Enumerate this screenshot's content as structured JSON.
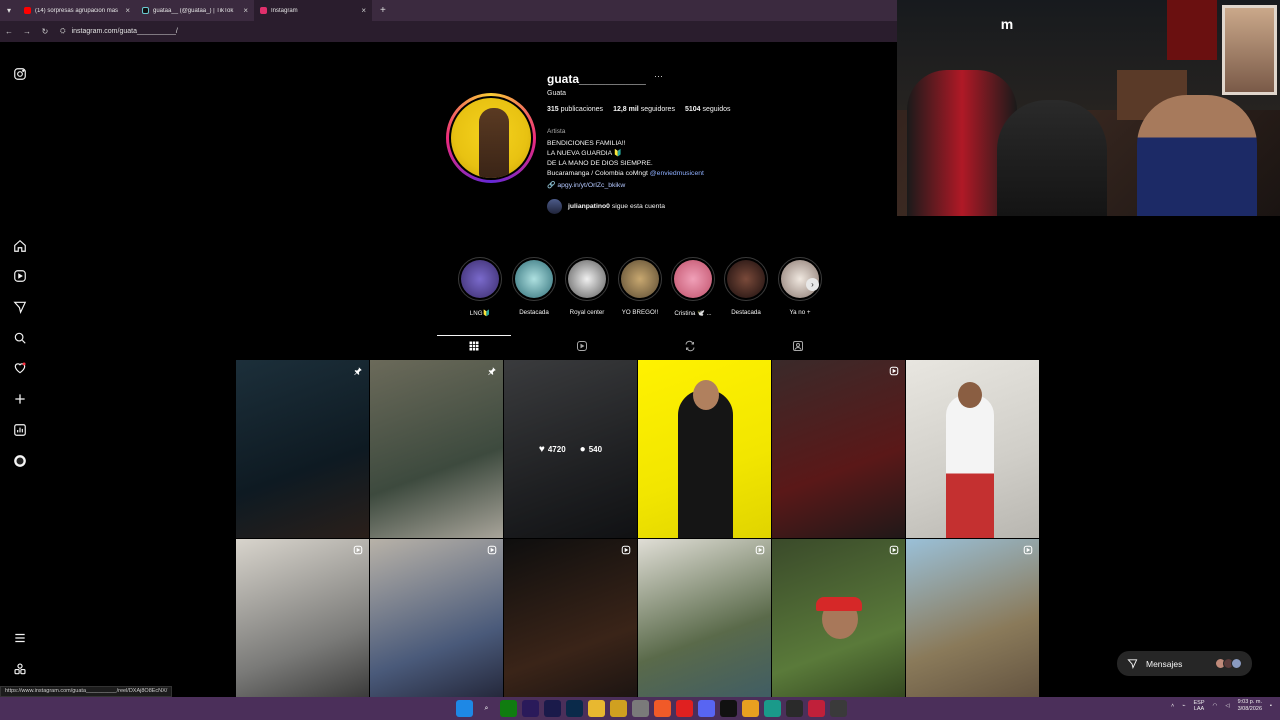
{
  "browser": {
    "tabs": [
      {
        "label": "(14) sorpresas agrupacion mas",
        "favicon_color": "#ff0000",
        "active": false
      },
      {
        "label": "guataa__ (@guataa_) | TikTok",
        "favicon_color": "#111111",
        "active": false
      },
      {
        "label": "Instagram",
        "favicon_color": "#e1306c",
        "active": true
      }
    ],
    "new_tab": "+",
    "close_glyph": "×",
    "url": "instagram.com/guata__________/",
    "status_link": "https://www.instagram.com/guata__________/reel/DXAj8O8EcNX/"
  },
  "profile": {
    "username": "guata__________",
    "more": "···",
    "full_name": "Guata",
    "stats": {
      "posts_count": "315",
      "posts_label": "publicaciones",
      "followers_count": "12,8 mil",
      "followers_label": "seguidores",
      "following_count": "5104",
      "following_label": "seguidos"
    },
    "category": "Artista",
    "bio_line1": "BENDICIONES FAMILIA!!",
    "bio_line2": "LA NUEVA GUARDIA 🔰",
    "bio_line3": "DE LA MANO DE DIOS SIEMPRE.",
    "bio_line4_prefix": "Bucaramanga / Colombia coMngt",
    "bio_mention": "@enviedmusicent",
    "link": "apgy.in/yt/OrlZc_bkikw",
    "followed_by_user": "julianpatino0",
    "followed_by_text": "sigue esta cuenta"
  },
  "highlights": [
    {
      "label": "LNG🔰",
      "color": "#3a2b6a"
    },
    {
      "label": "Destacada",
      "color": "#2f6e78"
    },
    {
      "label": "Royal center",
      "color": "#d8d8d8"
    },
    {
      "label": "YO BREGO!!",
      "color": "#5a4a32"
    },
    {
      "label": "Cristina 🕊️ ...",
      "color": "#c0506a"
    },
    {
      "label": "Destacada",
      "color": "#2a1a1a"
    },
    {
      "label": "Ya no +",
      "color": "#c8b8b0"
    }
  ],
  "hover_stats": {
    "likes": "4720",
    "comments": "540"
  },
  "posts": [
    {
      "bg": "linear-gradient(160deg,#1c2f3a,#0e1a22 60%,#2a1f1a)",
      "badge": "pin"
    },
    {
      "bg": "linear-gradient(160deg,#6b6a5a,#3d4a3e 60%,#a8a49a)",
      "badge": "pin"
    },
    {
      "bg": "linear-gradient(160deg,#6a6c70,#3a3c40 60%,#1e2024)",
      "badge": "none"
    },
    {
      "bg": "linear-gradient(160deg,#fff200,#f2e600 60%,#e0d400)",
      "badge": "none"
    },
    {
      "bg": "linear-gradient(160deg,#3a2a2a,#5a1818 60%,#201818)",
      "badge": "reel"
    },
    {
      "bg": "linear-gradient(160deg,#e8e6e0,#d0cec8 60%,#b8b6b0)",
      "badge": "none"
    },
    {
      "bg": "linear-gradient(160deg,#d8d4cc,#7a7a78 60%,#2a2a2a)",
      "badge": "reel"
    },
    {
      "bg": "linear-gradient(160deg,#b8b2a8,#4a5a7a 60%,#1a1a2a)",
      "badge": "reel"
    },
    {
      "bg": "linear-gradient(160deg,#0e0e0e,#3a2418 60%,#141010)",
      "badge": "reel"
    },
    {
      "bg": "linear-gradient(160deg,#e0ded6,#5a6a4a 55%,#3a5a6a)",
      "badge": "reel"
    },
    {
      "bg": "linear-gradient(160deg,#3a4a2a,#5a7a3a 60%,#2a3a1a)",
      "badge": "reel"
    },
    {
      "bg": "linear-gradient(160deg,#9ac0d8,#8a7a5a 55%,#5a4a3a)",
      "badge": "reel"
    }
  ],
  "messages": {
    "label": "Mensajes"
  },
  "taskbar": {
    "lang_line1": "ESP",
    "lang_line2": "LAA",
    "time": "9:03 p. m.",
    "date": "3/08/2026"
  }
}
